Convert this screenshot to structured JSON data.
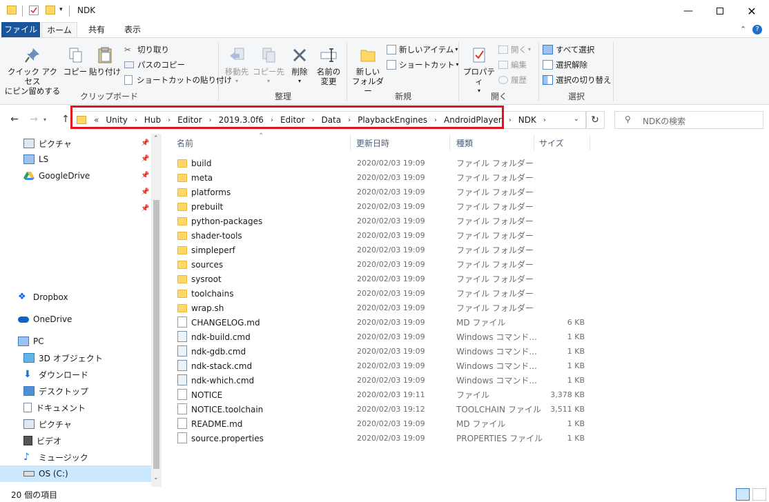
{
  "window": {
    "title": "NDK",
    "minimize_icon": "minimize-icon",
    "maximize_icon": "maximize-icon",
    "close_icon": "close-icon"
  },
  "ribbon_tabs": {
    "file": "ファイル",
    "home": "ホーム",
    "share": "共有",
    "view": "表示"
  },
  "ribbon": {
    "clipboard": {
      "label": "クリップボード",
      "pin_quick_access": "クイック アクセス\nにピン留めする",
      "pin_quick_access_l1": "クイック アクセス",
      "pin_quick_access_l2": "にピン留めする",
      "copy": "コピー",
      "paste": "貼り付け",
      "cut": "切り取り",
      "copy_path": "パスのコピー",
      "paste_shortcut": "ショートカットの貼り付け"
    },
    "organize": {
      "label": "整理",
      "move_to": "移動先",
      "copy_to": "コピー先",
      "delete": "削除",
      "rename_l1": "名前の",
      "rename_l2": "変更"
    },
    "new": {
      "label": "新規",
      "new_folder_l1": "新しい",
      "new_folder_l2": "フォルダー",
      "new_item": "新しいアイテム",
      "shortcut": "ショートカット"
    },
    "open": {
      "label": "開く",
      "properties": "プロパティ",
      "open": "開く",
      "edit": "編集",
      "history": "履歴"
    },
    "select": {
      "label": "選択",
      "select_all": "すべて選択",
      "select_none": "選択解除",
      "invert": "選択の切り替え"
    }
  },
  "address": {
    "overflow": "«",
    "breadcrumb": [
      "Unity",
      "Hub",
      "Editor",
      "2019.3.0f6",
      "Editor",
      "Data",
      "PlaybackEngines",
      "AndroidPlayer",
      "NDK"
    ]
  },
  "search": {
    "placeholder": "NDKの検索"
  },
  "nav": {
    "quick": [
      {
        "label": "ピクチャ",
        "icon": "pictures-icon"
      },
      {
        "label": "LS",
        "icon": "monitor-icon"
      },
      {
        "label": "GoogleDrive",
        "icon": "googledrive-icon"
      }
    ],
    "dropbox": "Dropbox",
    "onedrive": "OneDrive",
    "pc": "PC",
    "pc_items": [
      {
        "label": "3D オブジェクト",
        "icon": "3d-objects-icon"
      },
      {
        "label": "ダウンロード",
        "icon": "download-icon"
      },
      {
        "label": "デスクトップ",
        "icon": "desktop-icon"
      },
      {
        "label": "ドキュメント",
        "icon": "documents-icon"
      },
      {
        "label": "ピクチャ",
        "icon": "pictures-icon"
      },
      {
        "label": "ビデオ",
        "icon": "videos-icon"
      },
      {
        "label": "ミュージック",
        "icon": "music-icon"
      },
      {
        "label": "OS (C:)",
        "icon": "drive-icon"
      }
    ]
  },
  "columns": {
    "name": "名前",
    "date": "更新日時",
    "type": "種類",
    "size": "サイズ"
  },
  "files": [
    {
      "name": "build",
      "date": "2020/02/03 19:09",
      "type": "ファイル フォルダー",
      "size": "",
      "kind": "folder"
    },
    {
      "name": "meta",
      "date": "2020/02/03 19:09",
      "type": "ファイル フォルダー",
      "size": "",
      "kind": "folder"
    },
    {
      "name": "platforms",
      "date": "2020/02/03 19:09",
      "type": "ファイル フォルダー",
      "size": "",
      "kind": "folder"
    },
    {
      "name": "prebuilt",
      "date": "2020/02/03 19:09",
      "type": "ファイル フォルダー",
      "size": "",
      "kind": "folder"
    },
    {
      "name": "python-packages",
      "date": "2020/02/03 19:09",
      "type": "ファイル フォルダー",
      "size": "",
      "kind": "folder"
    },
    {
      "name": "shader-tools",
      "date": "2020/02/03 19:09",
      "type": "ファイル フォルダー",
      "size": "",
      "kind": "folder"
    },
    {
      "name": "simpleperf",
      "date": "2020/02/03 19:09",
      "type": "ファイル フォルダー",
      "size": "",
      "kind": "folder"
    },
    {
      "name": "sources",
      "date": "2020/02/03 19:09",
      "type": "ファイル フォルダー",
      "size": "",
      "kind": "folder"
    },
    {
      "name": "sysroot",
      "date": "2020/02/03 19:09",
      "type": "ファイル フォルダー",
      "size": "",
      "kind": "folder"
    },
    {
      "name": "toolchains",
      "date": "2020/02/03 19:09",
      "type": "ファイル フォルダー",
      "size": "",
      "kind": "folder"
    },
    {
      "name": "wrap.sh",
      "date": "2020/02/03 19:09",
      "type": "ファイル フォルダー",
      "size": "",
      "kind": "folder"
    },
    {
      "name": "CHANGELOG.md",
      "date": "2020/02/03 19:09",
      "type": "MD ファイル",
      "size": "6 KB",
      "kind": "doc"
    },
    {
      "name": "ndk-build.cmd",
      "date": "2020/02/03 19:09",
      "type": "Windows コマンド...",
      "size": "1 KB",
      "kind": "cmd"
    },
    {
      "name": "ndk-gdb.cmd",
      "date": "2020/02/03 19:09",
      "type": "Windows コマンド...",
      "size": "1 KB",
      "kind": "cmd"
    },
    {
      "name": "ndk-stack.cmd",
      "date": "2020/02/03 19:09",
      "type": "Windows コマンド...",
      "size": "1 KB",
      "kind": "cmd"
    },
    {
      "name": "ndk-which.cmd",
      "date": "2020/02/03 19:09",
      "type": "Windows コマンド...",
      "size": "1 KB",
      "kind": "cmd"
    },
    {
      "name": "NOTICE",
      "date": "2020/02/03 19:11",
      "type": "ファイル",
      "size": "3,378 KB",
      "kind": "doc"
    },
    {
      "name": "NOTICE.toolchain",
      "date": "2020/02/03 19:12",
      "type": "TOOLCHAIN ファイル",
      "size": "3,511 KB",
      "kind": "doc"
    },
    {
      "name": "README.md",
      "date": "2020/02/03 19:09",
      "type": "MD ファイル",
      "size": "1 KB",
      "kind": "doc"
    },
    {
      "name": "source.properties",
      "date": "2020/02/03 19:09",
      "type": "PROPERTIES ファイル",
      "size": "1 KB",
      "kind": "doc"
    }
  ],
  "status": {
    "count": "20 個の項目"
  },
  "colors": {
    "file_tab": "#19559b",
    "highlight_box": "#e0131f",
    "folder": "#ffd867",
    "selected": "#cce8ff"
  }
}
